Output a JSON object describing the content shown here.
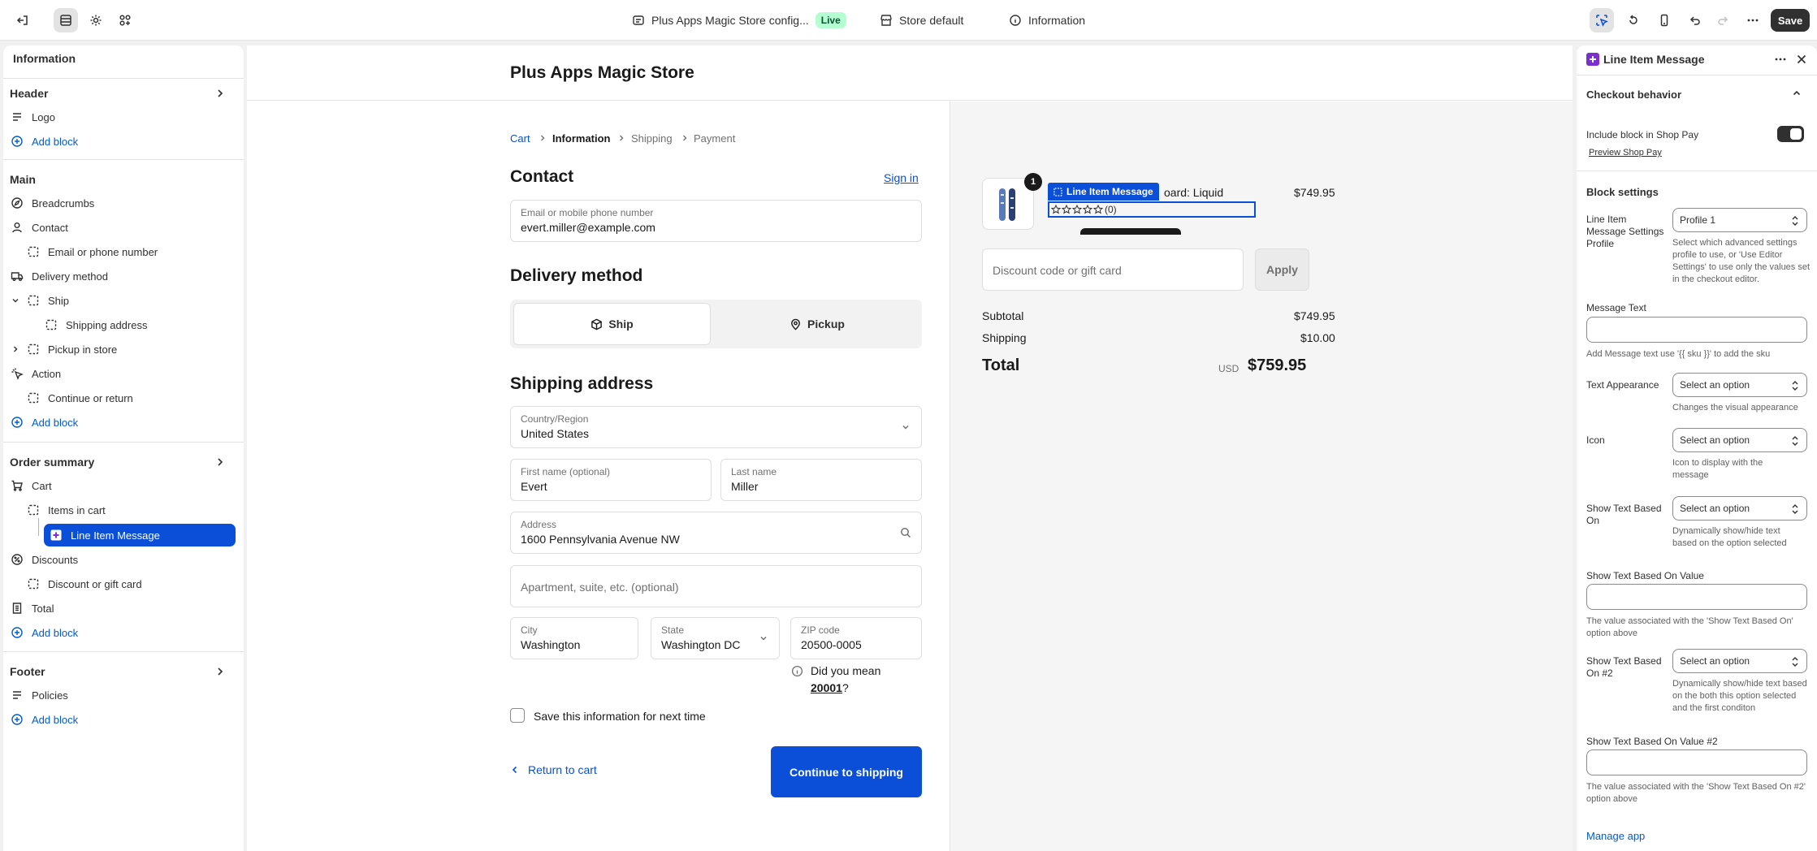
{
  "topbar": {
    "store_config": "Plus Apps Magic Store config...",
    "live_badge": "Live",
    "store_default": "Store default",
    "information": "Information",
    "save_label": "Save"
  },
  "sidebar": {
    "title": "Information",
    "header": {
      "label": "Header",
      "logo": "Logo",
      "add_block": "Add block"
    },
    "main": {
      "label": "Main",
      "breadcrumbs": "Breadcrumbs",
      "contact": "Contact",
      "email_or_phone": "Email or phone number",
      "delivery_method": "Delivery method",
      "ship": "Ship",
      "shipping_address": "Shipping address",
      "pickup_in_store": "Pickup in store",
      "action": "Action",
      "continue_or_return": "Continue or return",
      "add_block": "Add block"
    },
    "order_summary": {
      "label": "Order summary",
      "cart": "Cart",
      "items_in_cart": "Items in cart",
      "line_item_message": "Line Item Message",
      "discounts": "Discounts",
      "discount_or_gift_card": "Discount or gift card",
      "total": "Total",
      "add_block": "Add block"
    },
    "footer": {
      "label": "Footer",
      "policies": "Policies",
      "add_block": "Add block"
    }
  },
  "checkout": {
    "store_name": "Plus Apps Magic Store",
    "breadcrumbs": [
      "Cart",
      "Information",
      "Shipping",
      "Payment"
    ],
    "contact": {
      "heading": "Contact",
      "sign_in": "Sign in",
      "email_label": "Email or mobile phone number",
      "email_value": "evert.miller@example.com"
    },
    "delivery": {
      "heading": "Delivery method",
      "ship": "Ship",
      "pickup": "Pickup"
    },
    "shipping": {
      "heading": "Shipping address",
      "country_label": "Country/Region",
      "country_value": "United States",
      "first_name_label": "First name (optional)",
      "first_name_value": "Evert",
      "last_name_label": "Last name",
      "last_name_value": "Miller",
      "address_label": "Address",
      "address_value": "1600 Pennsylvania Avenue NW",
      "apartment_placeholder": "Apartment, suite, etc. (optional)",
      "city_label": "City",
      "city_value": "Washington",
      "state_label": "State",
      "state_value": "Washington DC",
      "zip_label": "ZIP code",
      "zip_value": "20500-0005",
      "did_you_mean": "Did you mean",
      "suggested_zip": "20001",
      "question_mark": "?",
      "save_info": "Save this information for next time"
    },
    "return_to_cart": "Return to cart",
    "continue_to_shipping": "Continue to shipping"
  },
  "order_summary": {
    "item_qty": "1",
    "item_name": "oard: Liquid",
    "item_price": "$749.95",
    "line_item_tag": "Line Item Message",
    "rating_count": "(0)",
    "rating": 0,
    "rating_max": 5,
    "discount_placeholder": "Discount code or gift card",
    "apply": "Apply",
    "subtotal_label": "Subtotal",
    "subtotal_value": "$749.95",
    "shipping_label": "Shipping",
    "shipping_value": "$10.00",
    "total_label": "Total",
    "currency": "USD",
    "total_value": "$759.95"
  },
  "panel": {
    "title": "Line Item Message",
    "checkout_behavior": "Checkout behavior",
    "include_shop_pay": "Include block in Shop Pay",
    "preview_shop_pay": "Preview Shop Pay",
    "block_settings": "Block settings",
    "profile_label": "Line Item Message Settings Profile",
    "profile_value": "Profile 1",
    "profile_help": "Select which advanced settings profile to use, or 'Use Editor Settings' to use only the values set in the checkout editor.",
    "message_text_label": "Message Text",
    "message_text_help": "Add Message text use '{{ sku }}' to add the sku",
    "text_appearance_label": "Text Appearance",
    "text_appearance_value": "Select an option",
    "text_appearance_help": "Changes the visual appearance",
    "icon_label": "Icon",
    "icon_value": "Select an option",
    "icon_help": "Icon to display with the message",
    "show_based_on_label": "Show Text Based On",
    "show_based_on_value": "Select an option",
    "show_based_on_help": "Dynamically show/hide text based on the option selected",
    "show_based_value_label": "Show Text Based On Value",
    "show_based_value_help": "The value associated with the 'Show Text Based On' option above",
    "show_based_on2_label": "Show Text Based On #2",
    "show_based_on2_value": "Select an option",
    "show_based_on2_help": "Dynamically show/hide text based on the both this option selected and the first conditon",
    "show_based_value2_label": "Show Text Based On Value #2",
    "show_based_value2_help": "The value associated with the 'Show Text Based On #2' option above",
    "manage_app": "Manage app"
  },
  "colors": {
    "accent": "#005bd3",
    "selected": "#0b4fd9",
    "primary_button": "#0b4fd9",
    "live": "#b4fed2"
  }
}
